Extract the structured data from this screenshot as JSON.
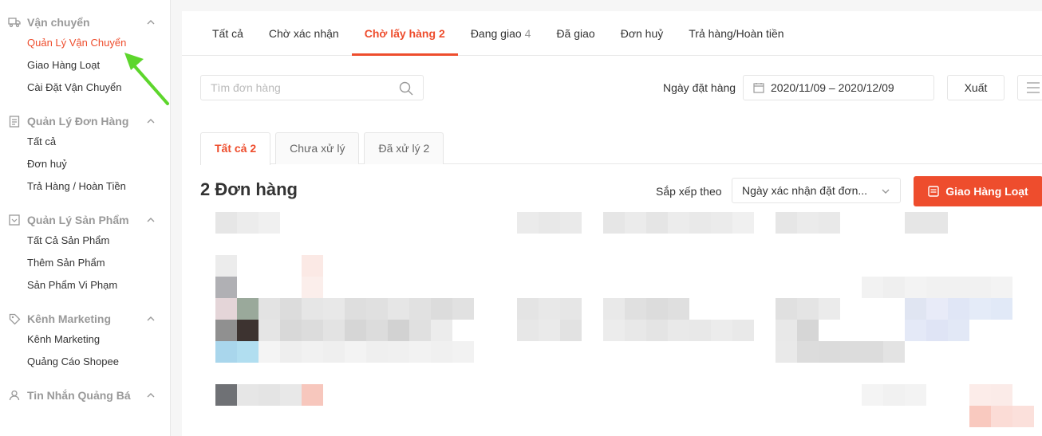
{
  "sidebar": {
    "sections": [
      {
        "title": "Vận chuyển",
        "icon": "truck-icon",
        "items": [
          "Quản Lý Vận Chuyển",
          "Giao Hàng Loạt",
          "Cài Đặt Vận Chuyển"
        ]
      },
      {
        "title": "Quản Lý Đơn Hàng",
        "icon": "clipboard-icon",
        "items": [
          "Tất cả",
          "Đơn huỷ",
          "Trả Hàng / Hoàn Tiền"
        ]
      },
      {
        "title": "Quản Lý Sản Phẩm",
        "icon": "product-box-icon",
        "items": [
          "Tất Cả Sản Phẩm",
          "Thêm Sản Phẩm",
          "Sản Phẩm Vi Phạm"
        ]
      },
      {
        "title": "Kênh Marketing",
        "icon": "tag-icon",
        "items": [
          "Kênh Marketing",
          "Quảng Cáo Shopee"
        ]
      },
      {
        "title": "Tin Nhắn Quảng Bá",
        "icon": "user-icon",
        "items": []
      }
    ],
    "active_item": "Quản Lý Vận Chuyển"
  },
  "tabs": [
    {
      "label": "Tất cả",
      "count": ""
    },
    {
      "label": "Chờ xác nhận",
      "count": ""
    },
    {
      "label": "Chờ lấy hàng",
      "count": "2"
    },
    {
      "label": "Đang giao",
      "count": "4"
    },
    {
      "label": "Đã giao",
      "count": ""
    },
    {
      "label": "Đơn huỷ",
      "count": ""
    },
    {
      "label": "Trả hàng/Hoàn tiền",
      "count": ""
    }
  ],
  "active_tab": "Chờ lấy hàng",
  "search": {
    "placeholder": "Tìm đơn hàng"
  },
  "date_filter": {
    "label": "Ngày đặt hàng",
    "value": "2020/11/09 – 2020/12/09"
  },
  "export_label": "Xuất",
  "subtabs": [
    "Tất cả 2",
    "Chưa xử lý",
    "Đã xử lý 2"
  ],
  "order_count": "2 Đơn hàng",
  "sort": {
    "label": "Sắp xếp theo",
    "value": "Ngày xác nhận đặt đơn..."
  },
  "bulk_ship_label": "Giao Hàng Loạt",
  "colors": {
    "accent": "#ee4d2d",
    "annotation_arrow": "#5dd62c"
  }
}
